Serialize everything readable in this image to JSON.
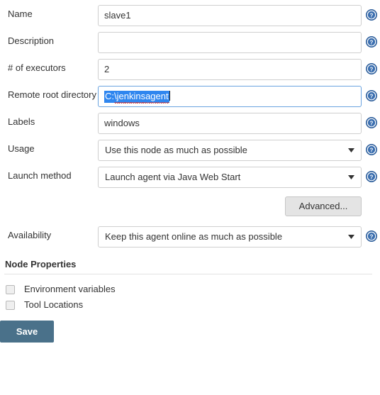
{
  "form": {
    "rows": [
      {
        "label": "Name",
        "type": "text",
        "value": "slave1",
        "placeholder": "",
        "focused": false,
        "help": "help-icon"
      },
      {
        "label": "Description",
        "type": "text",
        "value": "",
        "placeholder": "",
        "focused": false,
        "help": "help-icon"
      },
      {
        "label": "# of executors",
        "type": "text",
        "value": "2",
        "placeholder": "",
        "focused": false,
        "help": "help-icon"
      },
      {
        "label": "Remote root directory",
        "type": "text-selected",
        "value": "C:\\jenkinsagent",
        "placeholder": "",
        "focused": true,
        "help": "help-icon"
      },
      {
        "label": "Labels",
        "type": "text",
        "value": "windows",
        "placeholder": "",
        "focused": false,
        "help": "help-icon"
      },
      {
        "label": "Usage",
        "type": "select",
        "value": "Use this node as much as possible",
        "focused": false,
        "help": "help-icon"
      },
      {
        "label": "Launch method",
        "type": "select",
        "value": "Launch agent via Java Web Start",
        "focused": false,
        "help": "help-icon"
      }
    ],
    "advanced_label": "Advanced...",
    "availability": {
      "label": "Availability",
      "value": "Keep this agent online as much as possible",
      "help": "help-icon"
    }
  },
  "node_properties": {
    "title": "Node Properties",
    "checkboxes": [
      {
        "label": "Environment variables",
        "checked": false
      },
      {
        "label": "Tool Locations",
        "checked": false
      }
    ]
  },
  "actions": {
    "save_label": "Save"
  },
  "colors": {
    "save_button": "#4a718a",
    "help_icon": "#2b5d9b",
    "focus_border": "#6aa3e0",
    "selection": "#2f86ef",
    "spellcheck_underline": "#d02020",
    "input_border": "#cfcfcf",
    "advanced_button": "#e4e4e4",
    "text": "#333333"
  }
}
